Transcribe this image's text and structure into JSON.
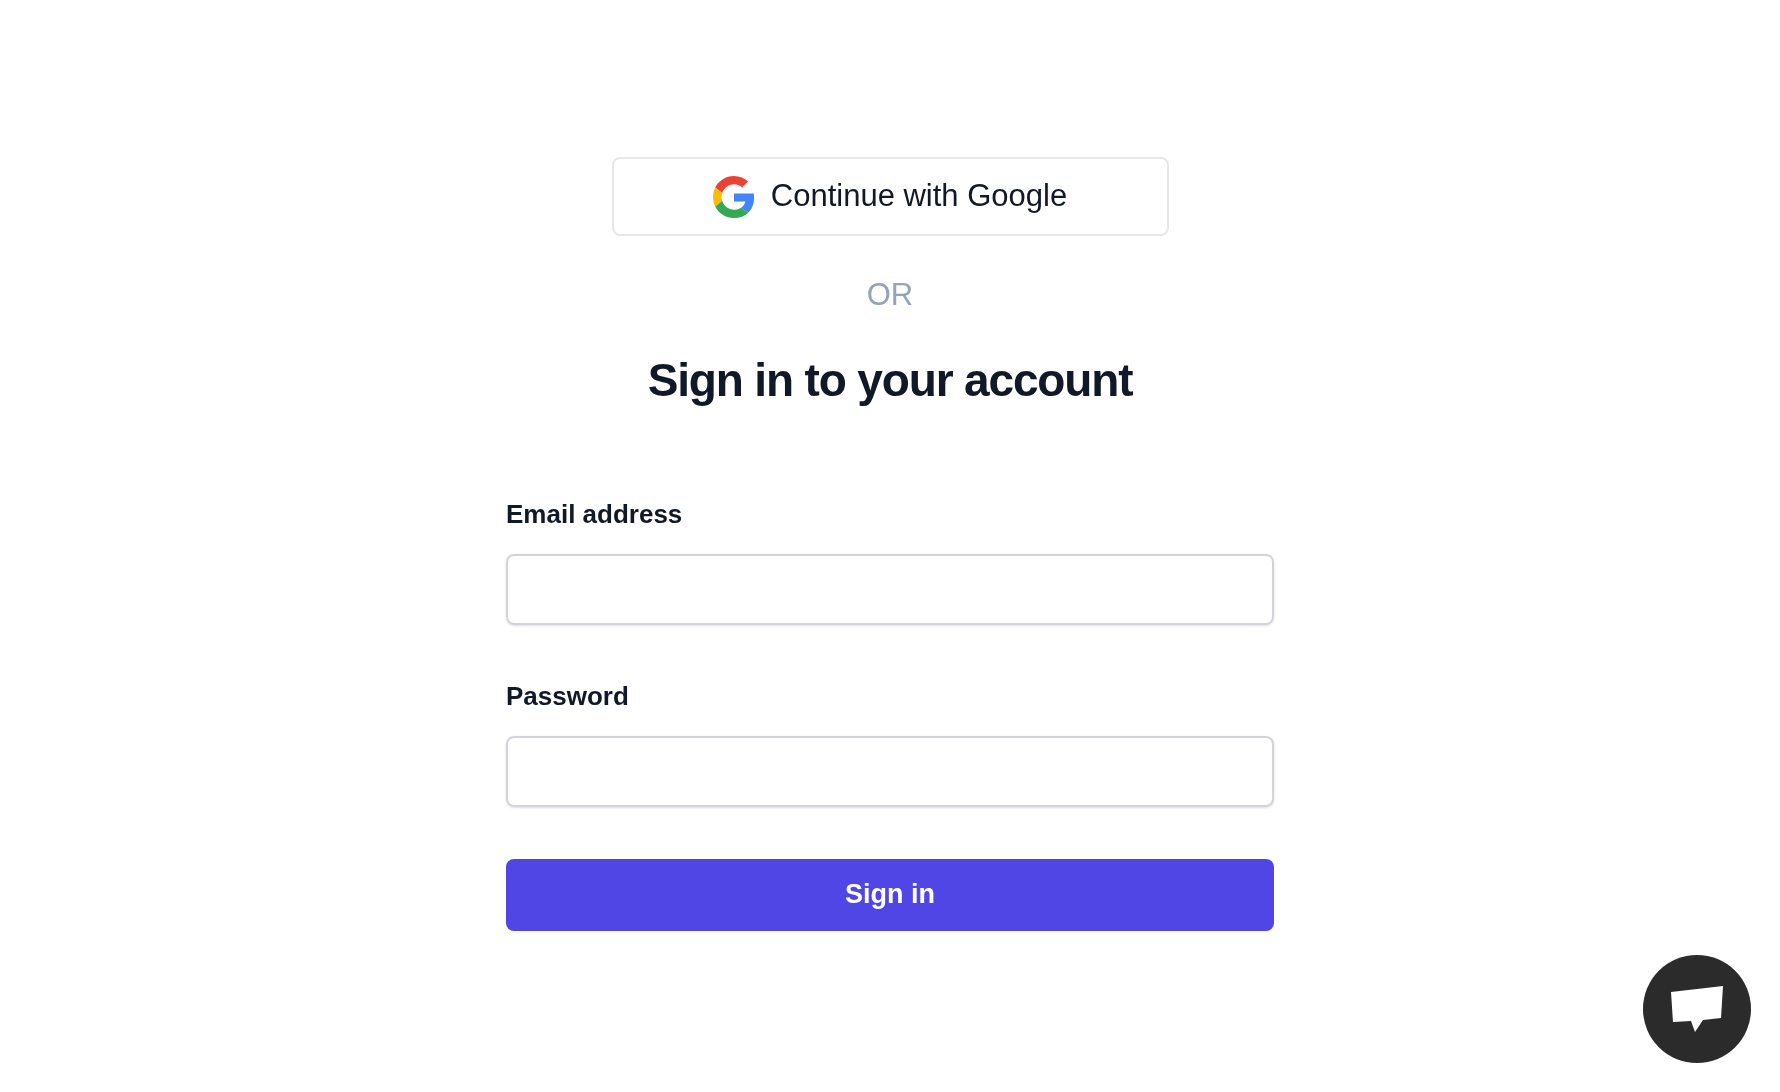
{
  "google_button": {
    "label": "Continue with Google"
  },
  "divider": "OR",
  "heading": "Sign in to your account",
  "fields": [
    {
      "label": "Email address"
    },
    {
      "label": "Password"
    }
  ],
  "submit_button": {
    "label": "Sign in"
  }
}
